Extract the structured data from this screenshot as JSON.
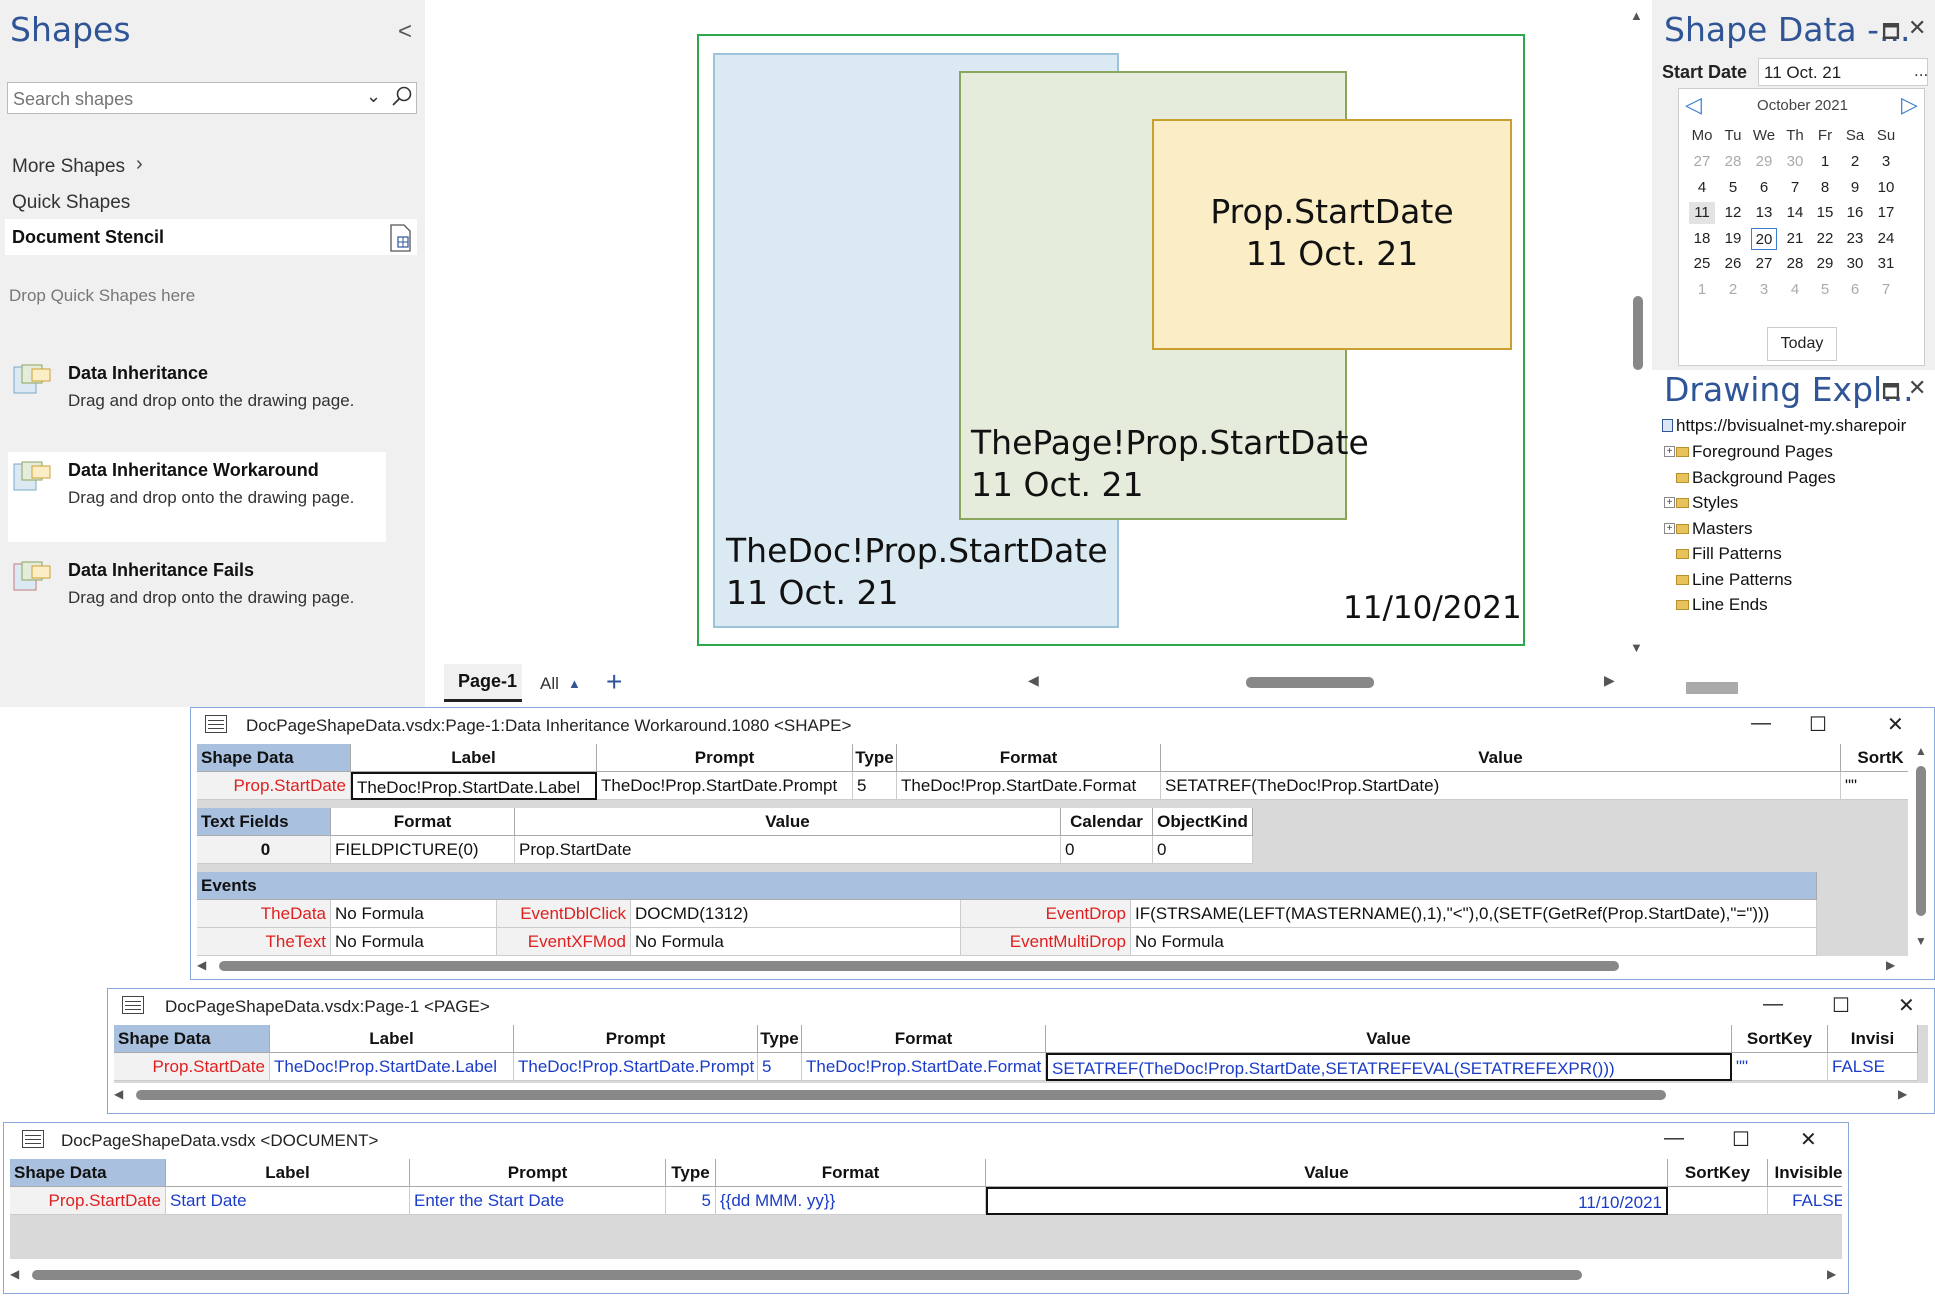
{
  "shapes_pane": {
    "title": "Shapes",
    "search_placeholder": "Search shapes",
    "more_shapes": "More Shapes",
    "quick_shapes": "Quick Shapes",
    "document_stencil": "Document Stencil",
    "drop_hint": "Drop Quick Shapes here",
    "masters": [
      {
        "name": "Data Inheritance",
        "desc": "Drag and drop onto the drawing page."
      },
      {
        "name": "Data Inheritance Workaround",
        "desc": "Drag and drop onto the drawing page."
      },
      {
        "name": "Data Inheritance Fails",
        "desc": "Drag and drop onto the drawing page."
      }
    ]
  },
  "canvas": {
    "doc_shape": {
      "line1": "TheDoc!Prop.StartDate",
      "line2": "11 Oct. 21"
    },
    "page_shape": {
      "line1": "ThePage!Prop.StartDate",
      "line2": "11 Oct. 21"
    },
    "shape_shape": {
      "line1": "Prop.StartDate",
      "line2": "11 Oct. 21"
    },
    "page_date": "11/10/2021",
    "tab_page": "Page-1",
    "tab_all": "All"
  },
  "shape_data_panel": {
    "title": "Shape Data -...",
    "field_label": "Start Date",
    "field_value": "11 Oct. 21",
    "dots": "...",
    "calendar": {
      "month": "October 2021",
      "day_headers": [
        "Mo",
        "Tu",
        "We",
        "Th",
        "Fr",
        "Sa",
        "Su"
      ],
      "weeks": [
        [
          "27",
          "28",
          "29",
          "30",
          "1",
          "2",
          "3"
        ],
        [
          "4",
          "5",
          "6",
          "7",
          "8",
          "9",
          "10"
        ],
        [
          "11",
          "12",
          "13",
          "14",
          "15",
          "16",
          "17"
        ],
        [
          "18",
          "19",
          "20",
          "21",
          "22",
          "23",
          "24"
        ],
        [
          "25",
          "26",
          "27",
          "28",
          "29",
          "30",
          "31"
        ],
        [
          "1",
          "2",
          "3",
          "4",
          "5",
          "6",
          "7"
        ]
      ],
      "today_button": "Today"
    }
  },
  "drawing_explorer": {
    "title": "Drawing Expl...",
    "root": "https://bvisualnet-my.sharepoir",
    "items": [
      "Foreground Pages",
      "Background Pages",
      "Styles",
      "Masters",
      "Fill Patterns",
      "Line Patterns",
      "Line Ends"
    ]
  },
  "ss_shape": {
    "title": "DocPageShapeData.vsdx:Page-1:Data Inheritance Workaround.1080 <SHAPE>",
    "data_headers": [
      "Shape Data",
      "Label",
      "Prompt",
      "Type",
      "Format",
      "Value",
      "SortK"
    ],
    "data_row": [
      "Prop.StartDate",
      "TheDoc!Prop.StartDate.Label",
      "TheDoc!Prop.StartDate.Prompt",
      "5",
      "TheDoc!Prop.StartDate.Format",
      "SETATREF(TheDoc!Prop.StartDate)",
      "\"\""
    ],
    "text_headers": [
      "Text Fields",
      "Format",
      "Value",
      "Calendar",
      "ObjectKind"
    ],
    "text_row": [
      "0",
      "FIELDPICTURE(0)",
      "Prop.StartDate",
      "0",
      "0"
    ],
    "events_header": "Events",
    "events_row": [
      "TheData",
      "No Formula",
      "EventDblClick",
      "DOCMD(1312)",
      "EventDrop",
      "IF(STRSAME(LEFT(MASTERNAME(),1),\"<\"),0,(SETF(GetRef(Prop.StartDate),\"=\")))"
    ],
    "events_row2": [
      "TheText",
      "No Formula",
      "EventXFMod",
      "No Formula",
      "EventMultiDrop",
      "No Formula"
    ]
  },
  "ss_page": {
    "title": "DocPageShapeData.vsdx:Page-1 <PAGE>",
    "headers": [
      "Shape Data",
      "Label",
      "Prompt",
      "Type",
      "Format",
      "Value",
      "SortKey",
      "Invisi"
    ],
    "row": [
      "Prop.StartDate",
      "TheDoc!Prop.StartDate.Label",
      "TheDoc!Prop.StartDate.Prompt",
      "5",
      "TheDoc!Prop.StartDate.Format",
      "SETATREF(TheDoc!Prop.StartDate,SETATREFEVAL(SETATREFEXPR()))",
      "\"\"",
      "FALSE"
    ]
  },
  "ss_doc": {
    "title": "DocPageShapeData.vsdx <DOCUMENT>",
    "headers": [
      "Shape Data",
      "Label",
      "Prompt",
      "Type",
      "Format",
      "Value",
      "SortKey",
      "Invisible"
    ],
    "row": [
      "Prop.StartDate",
      "Start Date",
      "Enter the Start Date",
      "5",
      "{{dd MMM. yy}}",
      "11/10/2021",
      "",
      "FALSE"
    ]
  },
  "colors": {
    "accent": "#2f5597",
    "row_name": "#e02020",
    "formula_blue": "#1a3cc8",
    "section_header": "#a9c0de"
  }
}
